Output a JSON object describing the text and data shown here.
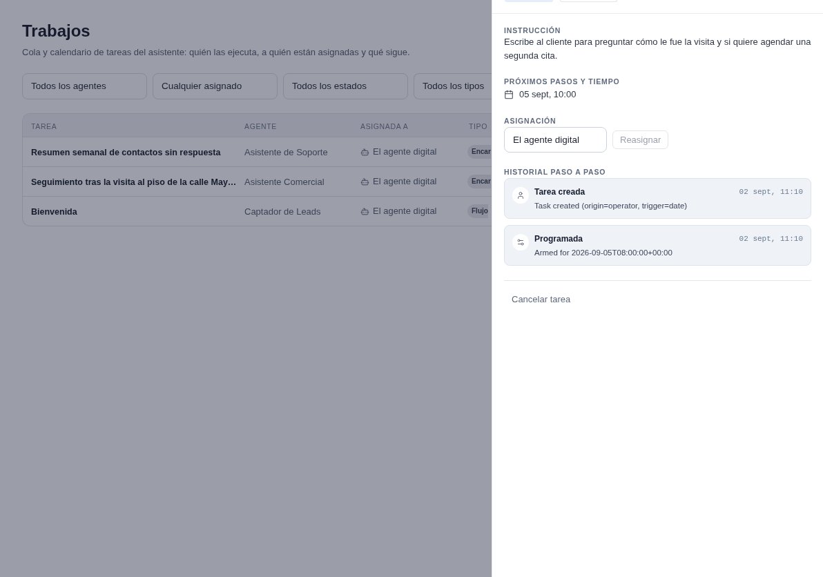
{
  "page": {
    "title": "Trabajos",
    "subtitle": "Cola y calendario de tareas del asistente: quién las ejecuta, a quién están asignadas y qué sigue."
  },
  "filters": [
    "Todos los agentes",
    "Cualquier asignado",
    "Todos los estados",
    "Todos los tipos"
  ],
  "table": {
    "columns": [
      "TAREA",
      "AGENTE",
      "ASIGNADA A",
      "TIPO"
    ],
    "rows": [
      {
        "task": "Resumen semanal de contactos sin respuesta",
        "agent": "Asistente de Soporte",
        "assigned_to": "El agente digital",
        "type": "Encar"
      },
      {
        "task": "Seguimiento tras la visita al piso de la calle May…",
        "agent": "Asistente Comercial",
        "assigned_to": "El agente digital",
        "type": "Encar"
      },
      {
        "task": "Bienvenida",
        "agent": "Captador de Leads",
        "assigned_to": "El agente digital",
        "type": "Flujo"
      }
    ]
  },
  "detail_panel": {
    "header_tabs": [
      {
        "selected": true
      },
      {
        "selected": false
      }
    ],
    "instruction": {
      "label": "INSTRUCCIÓN",
      "text": "Escribe al cliente para preguntar cómo le fue la visita y si quiere agendar una segunda cita."
    },
    "next_steps": {
      "label": "PRÓXIMOS PASOS Y TIEMPO",
      "date": "05 sept, 10:00"
    },
    "assignment": {
      "label": "ASIGNACIÓN",
      "value": "El agente digital",
      "button": {
        "label": "Reasignar",
        "disabled": true
      }
    },
    "history": {
      "label": "HISTORIAL PASO A PASO",
      "events": [
        {
          "kind": "created",
          "title": "Tarea creada",
          "detail": "Task created (origin=operator, trigger=date)",
          "time": "02 sept, 11:10"
        },
        {
          "kind": "scheduled",
          "title": "Programada",
          "detail": "Armed for 2026-09-05T08:00:00+00:00",
          "time": "02 sept, 11:10"
        }
      ]
    },
    "cancel_button": "Cancelar tarea"
  }
}
